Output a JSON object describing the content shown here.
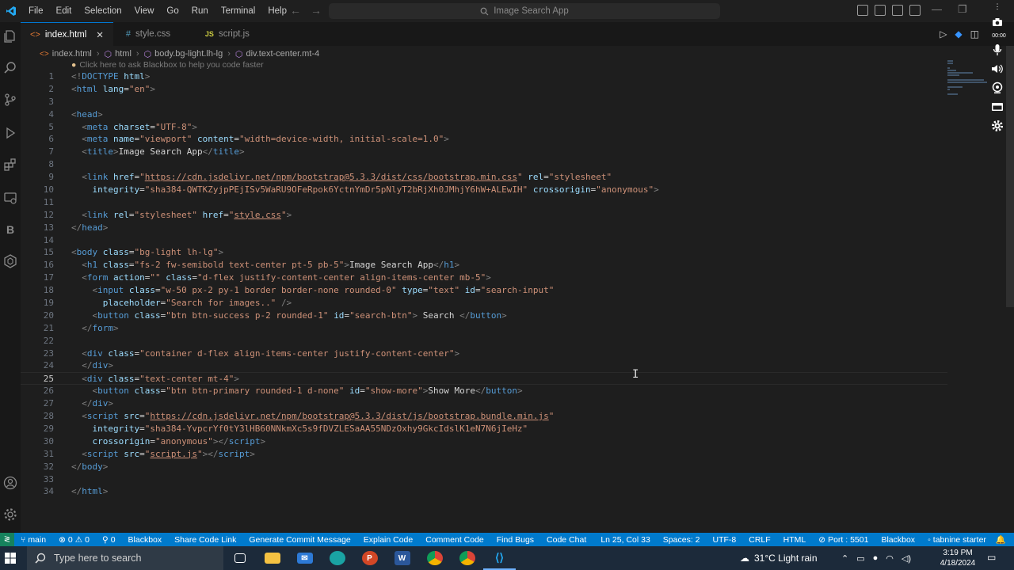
{
  "window": {
    "search_placeholder": "Image Search App"
  },
  "menu": [
    "File",
    "Edit",
    "Selection",
    "View",
    "Go",
    "Run",
    "Terminal",
    "Help"
  ],
  "tabs": [
    {
      "label": "index.html",
      "icon": "<>",
      "icon_color": "#e37933",
      "active": true
    },
    {
      "label": "style.css",
      "icon": "#",
      "icon_color": "#519aba",
      "active": false
    },
    {
      "label": "script.js",
      "icon": "JS",
      "icon_color": "#cbcb41",
      "active": false
    }
  ],
  "breadcrumb": [
    "index.html",
    "html",
    "body.bg-light.lh-lg",
    "div.text-center.mt-4"
  ],
  "hint": "Click here to ask Blackbox to help you code faster",
  "code_lines": [
    [
      [
        "br",
        "<!"
      ],
      [
        "tag",
        "DOCTYPE"
      ],
      [
        "text",
        " "
      ],
      [
        "attr",
        "html"
      ],
      [
        "br",
        ">"
      ]
    ],
    [
      [
        "br",
        "<"
      ],
      [
        "tag",
        "html"
      ],
      [
        "text",
        " "
      ],
      [
        "attr",
        "lang"
      ],
      [
        "text",
        "="
      ],
      [
        "str",
        "\"en\""
      ],
      [
        "br",
        ">"
      ]
    ],
    [],
    [
      [
        "br",
        "<"
      ],
      [
        "tag",
        "head"
      ],
      [
        "br",
        ">"
      ]
    ],
    [
      [
        "text",
        "  "
      ],
      [
        "br",
        "<"
      ],
      [
        "tag",
        "meta"
      ],
      [
        "text",
        " "
      ],
      [
        "attr",
        "charset"
      ],
      [
        "text",
        "="
      ],
      [
        "str",
        "\"UTF-8\""
      ],
      [
        "br",
        ">"
      ]
    ],
    [
      [
        "text",
        "  "
      ],
      [
        "br",
        "<"
      ],
      [
        "tag",
        "meta"
      ],
      [
        "text",
        " "
      ],
      [
        "attr",
        "name"
      ],
      [
        "text",
        "="
      ],
      [
        "str",
        "\"viewport\""
      ],
      [
        "text",
        " "
      ],
      [
        "attr",
        "content"
      ],
      [
        "text",
        "="
      ],
      [
        "str",
        "\"width=device-width, initial-scale=1.0\""
      ],
      [
        "br",
        ">"
      ]
    ],
    [
      [
        "text",
        "  "
      ],
      [
        "br",
        "<"
      ],
      [
        "tag",
        "title"
      ],
      [
        "br",
        ">"
      ],
      [
        "text",
        "Image Search App"
      ],
      [
        "br",
        "</"
      ],
      [
        "tag",
        "title"
      ],
      [
        "br",
        ">"
      ]
    ],
    [],
    [
      [
        "text",
        "  "
      ],
      [
        "br",
        "<"
      ],
      [
        "tag",
        "link"
      ],
      [
        "text",
        " "
      ],
      [
        "attr",
        "href"
      ],
      [
        "text",
        "="
      ],
      [
        "str",
        "\""
      ],
      [
        "url",
        "https://cdn.jsdelivr.net/npm/bootstrap@5.3.3/dist/css/bootstrap.min.css"
      ],
      [
        "str",
        "\""
      ],
      [
        "text",
        " "
      ],
      [
        "attr",
        "rel"
      ],
      [
        "text",
        "="
      ],
      [
        "str",
        "\"stylesheet\""
      ]
    ],
    [
      [
        "text",
        "    "
      ],
      [
        "attr",
        "integrity"
      ],
      [
        "text",
        "="
      ],
      [
        "str",
        "\"sha384-QWTKZyjpPEjISv5WaRU9OFeRpok6YctnYmDr5pNlyT2bRjXh0JMhjY6hW+ALEwIH\""
      ],
      [
        "text",
        " "
      ],
      [
        "attr",
        "crossorigin"
      ],
      [
        "text",
        "="
      ],
      [
        "str",
        "\"anonymous\""
      ],
      [
        "br",
        ">"
      ]
    ],
    [],
    [
      [
        "text",
        "  "
      ],
      [
        "br",
        "<"
      ],
      [
        "tag",
        "link"
      ],
      [
        "text",
        " "
      ],
      [
        "attr",
        "rel"
      ],
      [
        "text",
        "="
      ],
      [
        "str",
        "\"stylesheet\""
      ],
      [
        "text",
        " "
      ],
      [
        "attr",
        "href"
      ],
      [
        "text",
        "="
      ],
      [
        "str",
        "\""
      ],
      [
        "url",
        "style.css"
      ],
      [
        "str",
        "\""
      ],
      [
        "br",
        ">"
      ]
    ],
    [
      [
        "br",
        "</"
      ],
      [
        "tag",
        "head"
      ],
      [
        "br",
        ">"
      ]
    ],
    [],
    [
      [
        "br",
        "<"
      ],
      [
        "tag",
        "body"
      ],
      [
        "text",
        " "
      ],
      [
        "attr",
        "class"
      ],
      [
        "text",
        "="
      ],
      [
        "str",
        "\"bg-light lh-lg\""
      ],
      [
        "br",
        ">"
      ]
    ],
    [
      [
        "text",
        "  "
      ],
      [
        "br",
        "<"
      ],
      [
        "tag",
        "h1"
      ],
      [
        "text",
        " "
      ],
      [
        "attr",
        "class"
      ],
      [
        "text",
        "="
      ],
      [
        "str",
        "\"fs-2 fw-semibold text-center pt-5 pb-5\""
      ],
      [
        "br",
        ">"
      ],
      [
        "text",
        "Image Search App"
      ],
      [
        "br",
        "</"
      ],
      [
        "tag",
        "h1"
      ],
      [
        "br",
        ">"
      ]
    ],
    [
      [
        "text",
        "  "
      ],
      [
        "br",
        "<"
      ],
      [
        "tag",
        "form"
      ],
      [
        "text",
        " "
      ],
      [
        "attr",
        "action"
      ],
      [
        "text",
        "="
      ],
      [
        "str",
        "\"\""
      ],
      [
        "text",
        " "
      ],
      [
        "attr",
        "class"
      ],
      [
        "text",
        "="
      ],
      [
        "str",
        "\"d-flex justify-content-center align-items-center mb-5\""
      ],
      [
        "br",
        ">"
      ]
    ],
    [
      [
        "text",
        "    "
      ],
      [
        "br",
        "<"
      ],
      [
        "tag",
        "input"
      ],
      [
        "text",
        " "
      ],
      [
        "attr",
        "class"
      ],
      [
        "text",
        "="
      ],
      [
        "str",
        "\"w-50 px-2 py-1 border border-none rounded-0\""
      ],
      [
        "text",
        " "
      ],
      [
        "attr",
        "type"
      ],
      [
        "text",
        "="
      ],
      [
        "str",
        "\"text\""
      ],
      [
        "text",
        " "
      ],
      [
        "attr",
        "id"
      ],
      [
        "text",
        "="
      ],
      [
        "str",
        "\"search-input\""
      ]
    ],
    [
      [
        "text",
        "      "
      ],
      [
        "attr",
        "placeholder"
      ],
      [
        "text",
        "="
      ],
      [
        "str",
        "\"Search for images..\""
      ],
      [
        "text",
        " "
      ],
      [
        "br",
        "/>"
      ]
    ],
    [
      [
        "text",
        "    "
      ],
      [
        "br",
        "<"
      ],
      [
        "tag",
        "button"
      ],
      [
        "text",
        " "
      ],
      [
        "attr",
        "class"
      ],
      [
        "text",
        "="
      ],
      [
        "str",
        "\"btn btn-success p-2 rounded-1\""
      ],
      [
        "text",
        " "
      ],
      [
        "attr",
        "id"
      ],
      [
        "text",
        "="
      ],
      [
        "str",
        "\"search-btn\""
      ],
      [
        "br",
        ">"
      ],
      [
        "text",
        " Search "
      ],
      [
        "br",
        "</"
      ],
      [
        "tag",
        "button"
      ],
      [
        "br",
        ">"
      ]
    ],
    [
      [
        "text",
        "  "
      ],
      [
        "br",
        "</"
      ],
      [
        "tag",
        "form"
      ],
      [
        "br",
        ">"
      ]
    ],
    [],
    [
      [
        "text",
        "  "
      ],
      [
        "br",
        "<"
      ],
      [
        "tag",
        "div"
      ],
      [
        "text",
        " "
      ],
      [
        "attr",
        "class"
      ],
      [
        "text",
        "="
      ],
      [
        "str",
        "\"container d-flex align-items-center justify-content-center\""
      ],
      [
        "br",
        ">"
      ]
    ],
    [
      [
        "text",
        "  "
      ],
      [
        "br",
        "</"
      ],
      [
        "tag",
        "div"
      ],
      [
        "br",
        ">"
      ]
    ],
    [
      [
        "text",
        "  "
      ],
      [
        "br",
        "<"
      ],
      [
        "tag",
        "div"
      ],
      [
        "text",
        " "
      ],
      [
        "attr",
        "class"
      ],
      [
        "text",
        "="
      ],
      [
        "str",
        "\"text-center mt-4\""
      ],
      [
        "br",
        ">"
      ]
    ],
    [
      [
        "text",
        "    "
      ],
      [
        "br",
        "<"
      ],
      [
        "tag",
        "button"
      ],
      [
        "text",
        " "
      ],
      [
        "attr",
        "class"
      ],
      [
        "text",
        "="
      ],
      [
        "str",
        "\"btn btn-primary rounded-1 d-none\""
      ],
      [
        "text",
        " "
      ],
      [
        "attr",
        "id"
      ],
      [
        "text",
        "="
      ],
      [
        "str",
        "\"show-more\""
      ],
      [
        "br",
        ">"
      ],
      [
        "text",
        "Show More"
      ],
      [
        "br",
        "</"
      ],
      [
        "tag",
        "button"
      ],
      [
        "br",
        ">"
      ]
    ],
    [
      [
        "text",
        "  "
      ],
      [
        "br",
        "</"
      ],
      [
        "tag",
        "div"
      ],
      [
        "br",
        ">"
      ]
    ],
    [
      [
        "text",
        "  "
      ],
      [
        "br",
        "<"
      ],
      [
        "tag",
        "script"
      ],
      [
        "text",
        " "
      ],
      [
        "attr",
        "src"
      ],
      [
        "text",
        "="
      ],
      [
        "str",
        "\""
      ],
      [
        "url",
        "https://cdn.jsdelivr.net/npm/bootstrap@5.3.3/dist/js/bootstrap.bundle.min.js"
      ],
      [
        "str",
        "\""
      ]
    ],
    [
      [
        "text",
        "    "
      ],
      [
        "attr",
        "integrity"
      ],
      [
        "text",
        "="
      ],
      [
        "str",
        "\"sha384-YvpcrYf0tY3lHB60NNkmXc5s9fDVZLESaAA55NDzOxhy9GkcIdslK1eN7N6jIeHz\""
      ]
    ],
    [
      [
        "text",
        "    "
      ],
      [
        "attr",
        "crossorigin"
      ],
      [
        "text",
        "="
      ],
      [
        "str",
        "\"anonymous\""
      ],
      [
        "br",
        ">"
      ],
      [
        "br",
        "</"
      ],
      [
        "tag",
        "script"
      ],
      [
        "br",
        ">"
      ]
    ],
    [
      [
        "text",
        "  "
      ],
      [
        "br",
        "<"
      ],
      [
        "tag",
        "script"
      ],
      [
        "text",
        " "
      ],
      [
        "attr",
        "src"
      ],
      [
        "text",
        "="
      ],
      [
        "str",
        "\""
      ],
      [
        "url",
        "script.js"
      ],
      [
        "str",
        "\""
      ],
      [
        "br",
        ">"
      ],
      [
        "br",
        "</"
      ],
      [
        "tag",
        "script"
      ],
      [
        "br",
        ">"
      ]
    ],
    [
      [
        "br",
        "</"
      ],
      [
        "tag",
        "body"
      ],
      [
        "br",
        ">"
      ]
    ],
    [],
    [
      [
        "br",
        "</"
      ],
      [
        "tag",
        "html"
      ],
      [
        "br",
        ">"
      ]
    ]
  ],
  "current_line": 25,
  "overlay": {
    "time": "00:00"
  },
  "statusbar": {
    "branch": "main",
    "errors": "0",
    "warnings": "0",
    "ports": "0",
    "items_left": [
      "Blackbox",
      "Share Code Link",
      "Generate Commit Message",
      "Explain Code",
      "Comment Code",
      "Find Bugs",
      "Code Chat"
    ],
    "items_right": [
      "Ln 25, Col 33",
      "Spaces: 2",
      "UTF-8",
      "CRLF",
      "HTML",
      "Port : 5501",
      "Blackbox",
      "tabnine starter"
    ]
  },
  "taskbar": {
    "search_placeholder": "Type here to search",
    "weather": "31°C  Light rain",
    "time": "3:19 PM",
    "date": "4/18/2024"
  }
}
